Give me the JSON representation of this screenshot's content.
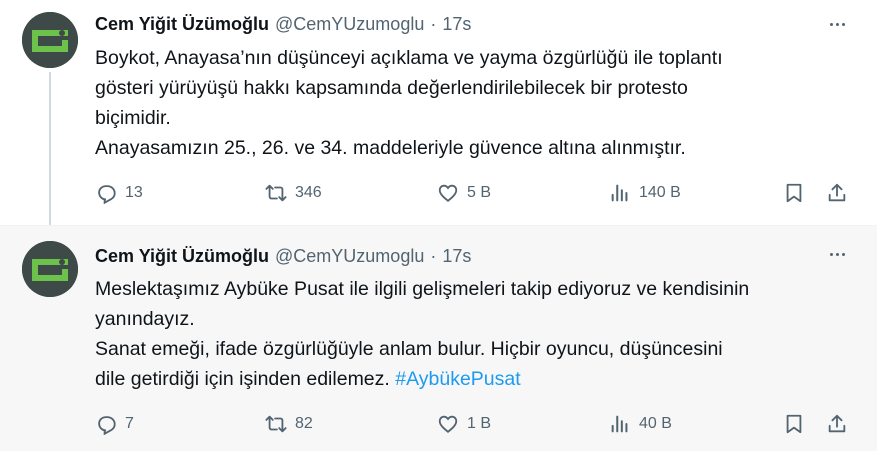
{
  "tweets": [
    {
      "author_name": "Cem Yiğit Üzümoğlu",
      "handle": "@CemYUzumoglu",
      "separator": "·",
      "time": "17s",
      "lines": [
        "Boykot, Anayasa’nın düşünceyi açıklama ve yayma özgürlüğü ile toplantı",
        "gösteri yürüyüşü hakkı kapsamında değerlendirilebilecek bir protesto",
        "biçimidir.",
        "Anayasamızın 25., 26. ve 34. maddeleriyle güvence altına alınmıştır."
      ],
      "replies": "13",
      "retweets": "346",
      "likes": "5 B",
      "views": "140 B"
    },
    {
      "author_name": "Cem Yiğit Üzümoğlu",
      "handle": "@CemYUzumoglu",
      "separator": "·",
      "time": "17s",
      "lines": [
        "Meslektaşımız Aybüke Pusat ile ilgili gelişmeleri takip ediyoruz ve kendisinin",
        "yanındayız.",
        "Sanat emeği, ifade özgürlüğüyle anlam bulur. Hiçbir oyuncu, düşüncesini",
        "dile getirdiği için işinden edilemez."
      ],
      "hashtag": "#AybükePusat",
      "replies": "7",
      "retweets": "82",
      "likes": "1 B",
      "views": "40 B"
    }
  ],
  "icons": {
    "reply": "reply-icon",
    "retweet": "retweet-icon",
    "like": "heart-icon",
    "views": "views-icon",
    "bookmark": "bookmark-icon",
    "share": "share-icon",
    "more": "more-icon"
  },
  "colors": {
    "text": "#0f1419",
    "secondary": "#536471",
    "link": "#1d9bf0",
    "thread_line": "#cfd9de",
    "avatar_bg": "#3d4a47",
    "avatar_fg": "#6cc24a"
  }
}
